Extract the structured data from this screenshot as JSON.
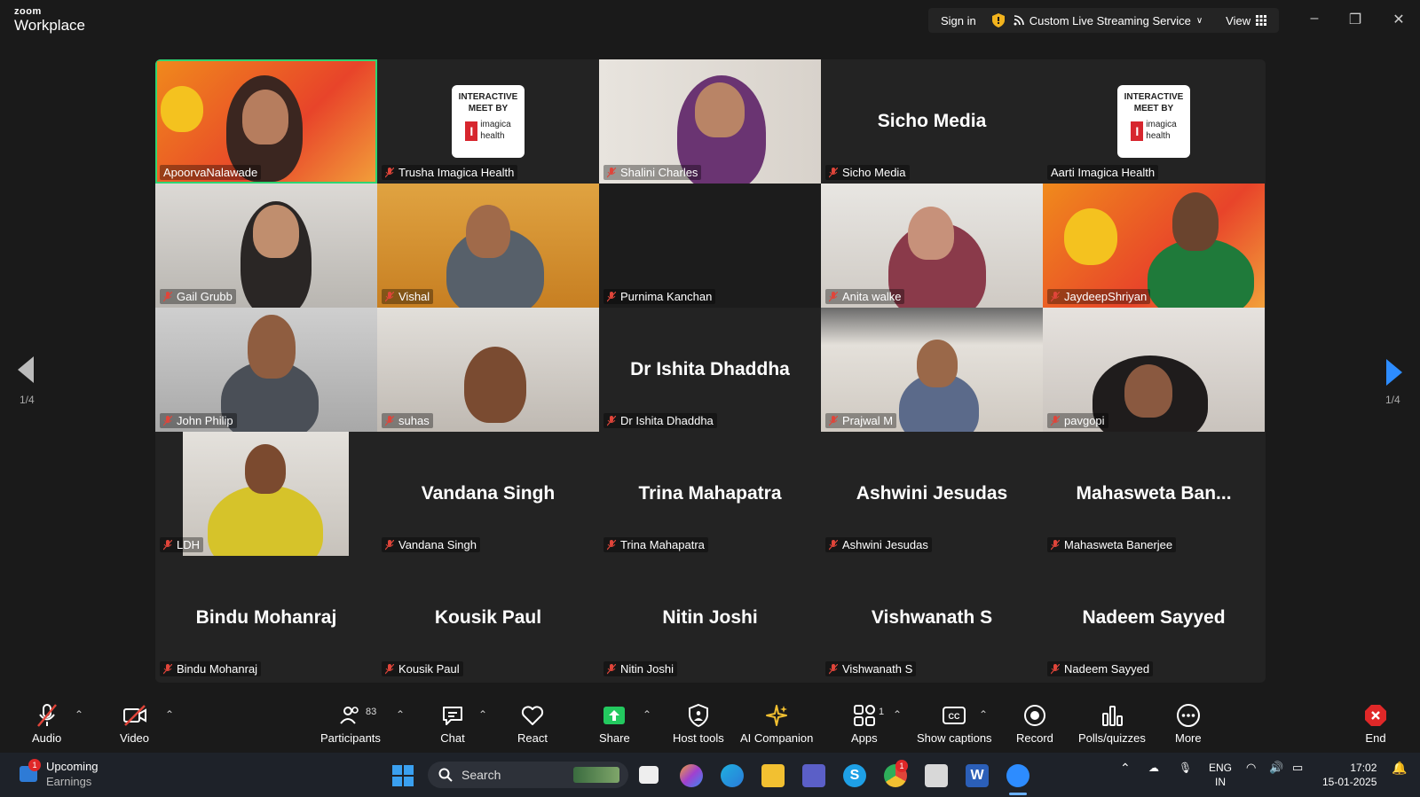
{
  "titlebar": {
    "logo_small": "zoom",
    "logo_big": "Workplace",
    "sign_in": "Sign in",
    "stream_label": "Custom Live Streaming Service",
    "view_label": "View"
  },
  "gallery": {
    "page_left": "1/4",
    "page_right": "1/4",
    "promo_text_line1": "INTERACTIVE",
    "promo_text_line2": "MEET BY",
    "promo_brand_line1": "imagica",
    "promo_brand_line2": "health",
    "tiles": [
      {
        "label": "ApoorvaNalawade",
        "big": ""
      },
      {
        "label": "Trusha Imagica Health",
        "big": ""
      },
      {
        "label": "Shalini Charles",
        "big": ""
      },
      {
        "label": "Sicho Media",
        "big": "Sicho Media"
      },
      {
        "label": "Aarti Imagica Health",
        "big": ""
      },
      {
        "label": "Gail Grubb",
        "big": ""
      },
      {
        "label": "Vishal",
        "big": ""
      },
      {
        "label": "Purnima Kanchan",
        "big": ""
      },
      {
        "label": "Anita walke",
        "big": ""
      },
      {
        "label": "JaydeepShriyan",
        "big": ""
      },
      {
        "label": "John Philip",
        "big": ""
      },
      {
        "label": "suhas",
        "big": ""
      },
      {
        "label": "Dr Ishita Dhaddha",
        "big": "Dr Ishita Dhaddha"
      },
      {
        "label": "Prajwal M",
        "big": ""
      },
      {
        "label": "pavgopi",
        "big": ""
      },
      {
        "label": "LDH",
        "big": ""
      },
      {
        "label": "Vandana Singh",
        "big": "Vandana Singh"
      },
      {
        "label": "Trina Mahapatra",
        "big": "Trina Mahapatra"
      },
      {
        "label": "Ashwini Jesudas",
        "big": "Ashwini Jesudas"
      },
      {
        "label": "Mahasweta Banerjee",
        "big": "Mahasweta  Ban..."
      },
      {
        "label": "Bindu Mohanraj",
        "big": "Bindu Mohanraj"
      },
      {
        "label": "Kousik Paul",
        "big": "Kousik Paul"
      },
      {
        "label": "Nitin Joshi",
        "big": "Nitin Joshi"
      },
      {
        "label": "Vishwanath S",
        "big": "Vishwanath S"
      },
      {
        "label": "Nadeem Sayyed",
        "big": "Nadeem Sayyed"
      }
    ]
  },
  "toolbar": {
    "audio": "Audio",
    "video": "Video",
    "participants": "Participants",
    "participants_count": "83",
    "chat": "Chat",
    "react": "React",
    "share": "Share",
    "host_tools": "Host tools",
    "ai_companion": "AI Companion",
    "apps": "Apps",
    "apps_count": "1",
    "show_captions": "Show captions",
    "record": "Record",
    "polls": "Polls/quizzes",
    "more": "More",
    "end": "End"
  },
  "taskbar": {
    "weather_badge": "1",
    "weather_title": "Upcoming",
    "weather_sub": "Earnings",
    "search_placeholder": "Search",
    "chrome_badge": "1",
    "lang": "ENG",
    "region": "IN",
    "time": "17:02",
    "date": "15-01-2025"
  },
  "colors": {
    "accent_green": "#2ed573",
    "zoom_blue": "#2d8cff",
    "end_red": "#e02828",
    "muted_red": "#e0453a"
  }
}
